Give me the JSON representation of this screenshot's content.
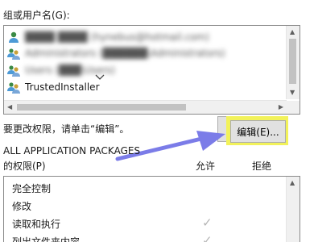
{
  "group_label": "组或用户名(G):",
  "users": [
    {
      "name": "████ ████ (hynebus@hotmail.com)",
      "blurred": true,
      "icon": "user-icon"
    },
    {
      "name": "Administrators (██████\\Administrators)",
      "blurred": true,
      "icon": "group-icon"
    },
    {
      "name": "Users (███\\Users)",
      "blurred": true,
      "icon": "group-icon"
    },
    {
      "name": "TrustedInstaller",
      "blurred": false,
      "icon": "group-icon"
    }
  ],
  "change_hint": "要更改权限，请单击“编辑”。",
  "edit_button": "编辑(E)...",
  "selected_principal": "ALL APPLICATION PACKAGES",
  "perm_header": {
    "label": "的权限(P)",
    "allow": "允许",
    "deny": "拒绝"
  },
  "permissions": [
    {
      "name": "完全控制",
      "allow": false
    },
    {
      "name": "修改",
      "allow": false
    },
    {
      "name": "读取和执行",
      "allow": true
    },
    {
      "name": "列出文件夹内容",
      "allow": true
    }
  ],
  "colors": {
    "highlight": "#f2f25a",
    "arrow": "#7b7ce8"
  }
}
